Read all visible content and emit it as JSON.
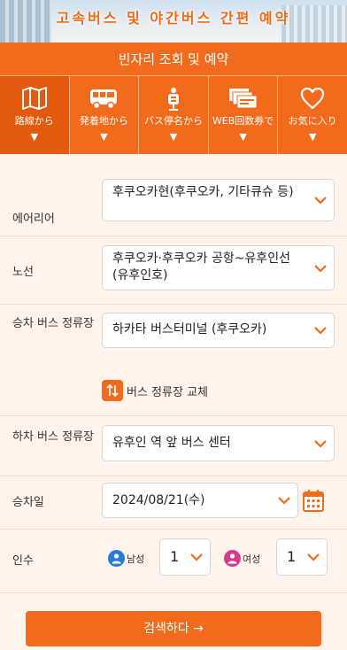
{
  "banner": {
    "title": "고속버스 및 야간버스 간편 예약"
  },
  "header": {
    "title": "빈자리 조회 및 예약"
  },
  "nav": {
    "items": [
      {
        "label": "路線から",
        "caret": "▼",
        "icon": "map-icon"
      },
      {
        "label": "発着地から",
        "caret": "▼",
        "icon": "bus-icon"
      },
      {
        "label": "バス停名から",
        "caret": "▼",
        "icon": "bus-stop-icon"
      },
      {
        "label": "WEB回数券で",
        "caret": "▼",
        "icon": "ticket-book-icon"
      },
      {
        "label": "お気に入り",
        "caret": "▼",
        "icon": "heart-icon"
      }
    ]
  },
  "form": {
    "area": {
      "label": "에어리어",
      "value": "후쿠오카현(후쿠오카, 기타큐슈 등)"
    },
    "route": {
      "label": "노선",
      "value": "후쿠오카·후쿠오카 공항~유후인선(유후인호)"
    },
    "boarding": {
      "label": "승차 버스 정류장",
      "value": "하카타 버스터미널 (후쿠오카)"
    },
    "swap": {
      "label": "버스 정류장 교체"
    },
    "alighting": {
      "label": "하차 버스 정류장",
      "value": "유후인 역 앞 버스 센터"
    },
    "date": {
      "label": "승차일",
      "value": "2024/08/21(수)"
    },
    "passengers": {
      "label": "인수",
      "male_label": "남성",
      "male_value": "1",
      "female_label": "여성",
      "female_value": "1"
    },
    "search_label": "검색하다 →"
  },
  "colors": {
    "accent": "#f26b1d",
    "form_bg": "#fef4ec",
    "male": "#2a7bd3",
    "female": "#d63b93"
  }
}
